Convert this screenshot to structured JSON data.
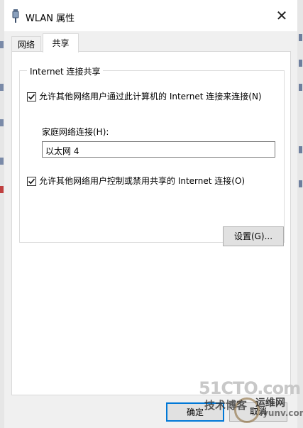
{
  "window": {
    "title": "WLAN 属性",
    "close_glyph": "✕"
  },
  "tabs": [
    {
      "label": "网络",
      "active": false
    },
    {
      "label": "共享",
      "active": true
    }
  ],
  "group": {
    "legend": "Internet 连接共享",
    "allow_connect": {
      "label": "允许其他网络用户通过此计算机的 Internet 连接来连接(N)",
      "checked": true
    },
    "home_network_label": "家庭网络连接(H):",
    "home_network_value": "以太网 4",
    "allow_control": {
      "label": "允许其他网络用户控制或禁用共享的 Internet 连接(O)",
      "checked": true
    },
    "settings_button": "设置(G)..."
  },
  "footer": {
    "ok_button": "确定",
    "cancel_button": "取消"
  },
  "watermark": {
    "site": "51CTO.com",
    "tagline": "技术博客",
    "brand": "运维网",
    "brand_url": "iyunv.com"
  },
  "colors": {
    "accent": "#0078d7",
    "dialog_bg": "#f0f0f0",
    "panel_bg": "#ffffff"
  },
  "icons": {
    "title_icon": "wlan-adapter-icon",
    "close_icon": "close-icon",
    "checkbox_icon": "checkmark-icon"
  }
}
